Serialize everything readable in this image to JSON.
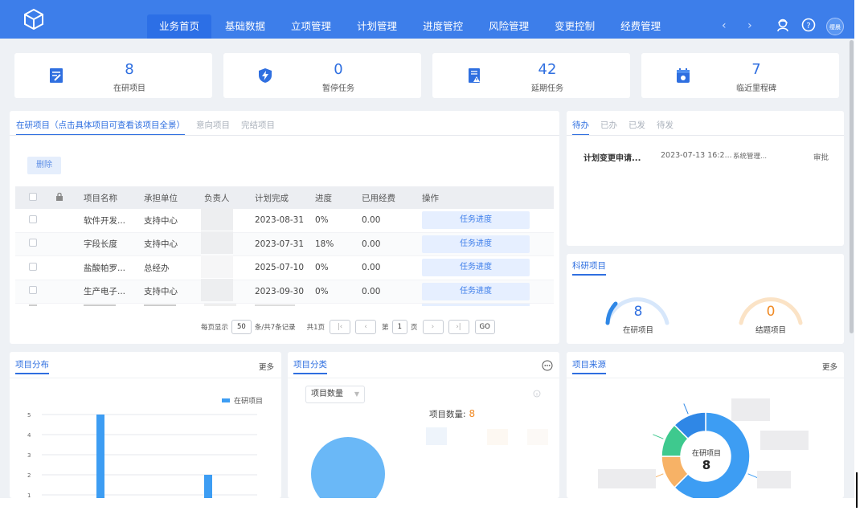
{
  "nav": {
    "items": [
      "业务首页",
      "基础数据",
      "立项管理",
      "计划管理",
      "进度管控",
      "风险管理",
      "变更控制",
      "经费管理"
    ],
    "arrow_left": "‹",
    "arrow_right": "›",
    "avatar_text": "缨晨"
  },
  "stats": [
    {
      "value": "8",
      "label": "在研项目",
      "icon": "project-edit-icon"
    },
    {
      "value": "0",
      "label": "暂停任务",
      "icon": "shield-bolt-icon"
    },
    {
      "value": "42",
      "label": "延期任务",
      "icon": "document-warning-icon"
    },
    {
      "value": "7",
      "label": "临近里程碑",
      "icon": "calendar-icon"
    }
  ],
  "projects": {
    "tabs": [
      "在研项目（点击具体项目可查看该项目全景）",
      "意向项目",
      "完结项目"
    ],
    "delete_label": "删除",
    "columns": [
      "项目名称",
      "承担单位",
      "负责人",
      "计划完成",
      "进度",
      "已用经费",
      "操作"
    ],
    "rows": [
      {
        "name": "软件开发...",
        "unit": "支持中心",
        "date": "2023-08-31",
        "progress": "0%",
        "fee": "0.00",
        "action": "任务进度"
      },
      {
        "name": "字段长度",
        "unit": "支持中心",
        "date": "2023-07-31",
        "progress": "18%",
        "fee": "0.00",
        "action": "任务进度"
      },
      {
        "name": "盐酸帕罗...",
        "unit": "总经办",
        "date": "2025-07-10",
        "progress": "0%",
        "fee": "0.00",
        "action": "任务进度"
      },
      {
        "name": "生产电子...",
        "unit": "支持中心",
        "date": "2023-09-30",
        "progress": "0%",
        "fee": "0.00",
        "action": "任务进度"
      }
    ],
    "pager": {
      "per_page_label": "每页显示",
      "per_page": "50",
      "total_label": "条/共7条记录",
      "pages_label": "共1页",
      "page_prefix": "第",
      "page": "1",
      "page_suffix": "页",
      "go": "GO"
    }
  },
  "todo": {
    "tabs": [
      "待办",
      "已办",
      "已发",
      "待发"
    ],
    "row": {
      "title": "计划变更申请...",
      "time": "2023-07-13 16:2...",
      "sender": "系统管理...",
      "type": "审批"
    }
  },
  "research": {
    "title": "科研项目",
    "in_progress_value": "8",
    "in_progress_label": "在研项目",
    "closed_value": "0",
    "closed_label": "结题项目"
  },
  "distribution": {
    "title": "项目分布",
    "more": "更多",
    "legend": "在研项目"
  },
  "category": {
    "title": "项目分类",
    "select_value": "项目数量",
    "value_label": "项目数量:",
    "value": "8"
  },
  "source": {
    "title": "项目来源",
    "more": "更多",
    "center_label": "在研项目",
    "center_value": "8"
  },
  "chart_data": [
    {
      "type": "bar",
      "title": "",
      "series": [
        {
          "name": "在研项目",
          "values": [
            5,
            2
          ]
        }
      ],
      "ylim": [
        0,
        5
      ],
      "yticks": [
        "1",
        "2",
        "3",
        "4",
        "5"
      ],
      "grid": true,
      "legend": "top-right"
    },
    {
      "type": "pie",
      "values": [
        8
      ],
      "colors": [
        "#6ab8f7"
      ]
    },
    {
      "type": "pie",
      "center_label": "在研项目",
      "center_value": "8",
      "values": [
        5,
        1,
        1,
        1
      ],
      "colors": [
        "#3d9df3",
        "#f7b266",
        "#3ec98e",
        "#2f87e6"
      ]
    }
  ],
  "colors": {
    "primary": "#3d7eea",
    "accent": "#2f6fe0",
    "orange": "#f08a24"
  }
}
